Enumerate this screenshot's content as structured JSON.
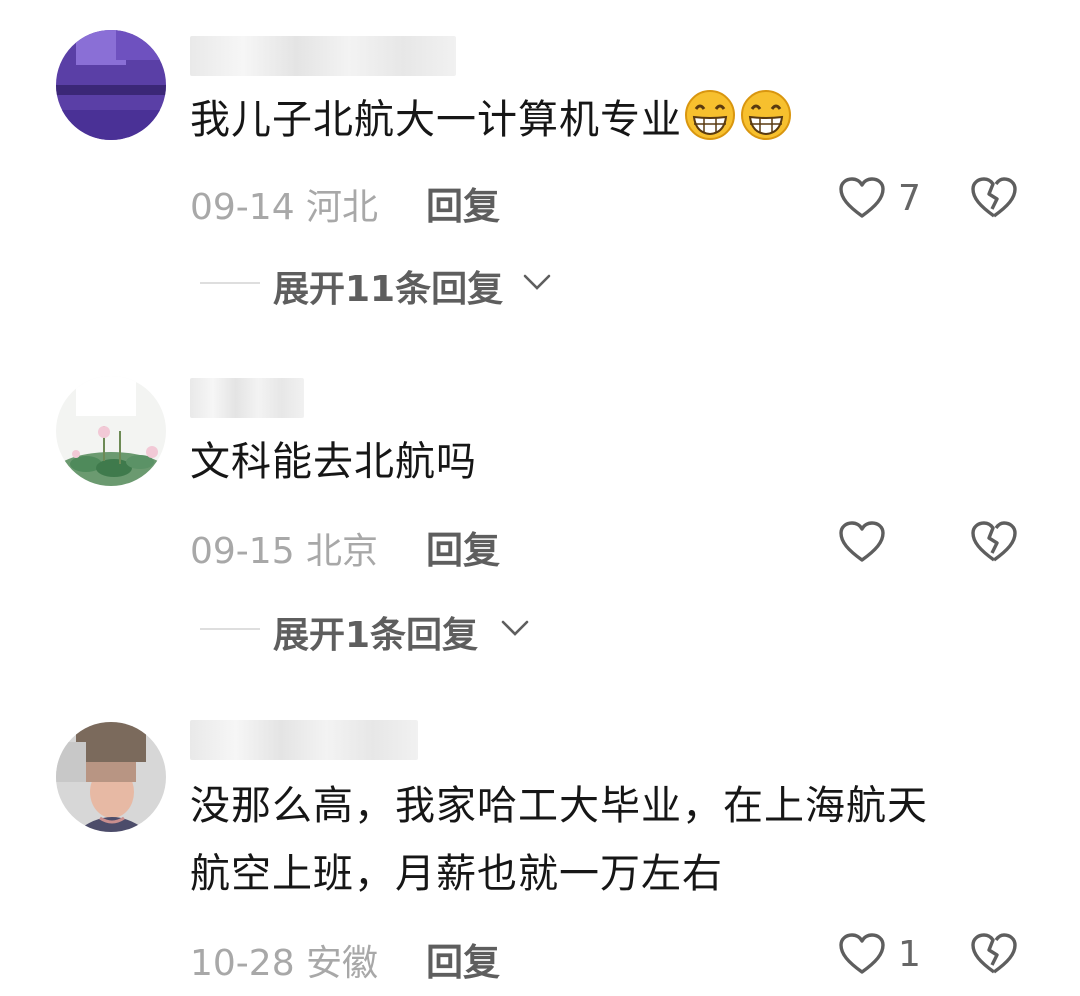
{
  "comments": [
    {
      "text": "我儿子北航大一计算机专业",
      "emojis": [
        "grinning-face",
        "grinning-face"
      ],
      "date": "09-14 河北",
      "reply_label": "回复",
      "like_count": "7",
      "expand_label": "展开11条回复"
    },
    {
      "text": "文科能去北航吗",
      "date": "09-15 北京",
      "reply_label": "回复",
      "like_count": "",
      "expand_label": "展开1条回复"
    },
    {
      "text_line1": "没那么高，我家哈工大毕业，在上海航天",
      "text_line2": "航空上班，月薪也就一万左右",
      "date": "10-28 安徽",
      "reply_label": "回复",
      "like_count": "1"
    }
  ],
  "icons": {
    "like": "heart-outline-icon",
    "dislike": "broken-heart-icon",
    "expand": "chevron-down-icon"
  },
  "colors": {
    "text": "#161616",
    "meta": "#a8a8a8",
    "action": "#5e5e5e"
  }
}
